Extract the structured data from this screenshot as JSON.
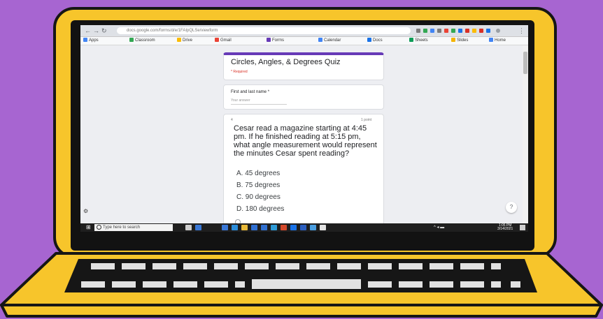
{
  "scene": {
    "background_color": "#a765d1",
    "laptop_color": "#f7c52b",
    "outline_color": "#161616"
  },
  "browser": {
    "url_text": "docs.google.com/forms/d/e/1FAIpQLSe/viewform",
    "nav_icons": [
      "back-arrow-icon",
      "forward-arrow-icon",
      "reload-icon"
    ],
    "bookmarks": [
      "Apps",
      "Classroom",
      "Drive",
      "Gmail",
      "Forms",
      "Calendar",
      "Docs",
      "Sheets",
      "Slides",
      "Home"
    ]
  },
  "form": {
    "title": "Circles, Angles, & Degrees Quiz",
    "required_note": "* Required",
    "name_label": "First and last name *",
    "name_placeholder": "Your answer",
    "question_number": "4",
    "question_points": "1 point",
    "question": "Cesar read a magazine starting at 4:45 pm. If he finished reading at 5:15 pm, what angle measurement would represent the minutes Cesar spent reading?",
    "options": [
      {
        "letter": "A.",
        "text": "45 degrees"
      },
      {
        "letter": "B.",
        "text": "75 degrees"
      },
      {
        "letter": "C.",
        "text": "90 degrees"
      },
      {
        "letter": "D.",
        "text": "180 degrees"
      }
    ],
    "help_icon": "?"
  },
  "taskbar": {
    "search_placeholder": "Type here to search",
    "tray_text": "^  ◂  ▬",
    "time": "1:05 PM",
    "date": "3/14/2021"
  }
}
